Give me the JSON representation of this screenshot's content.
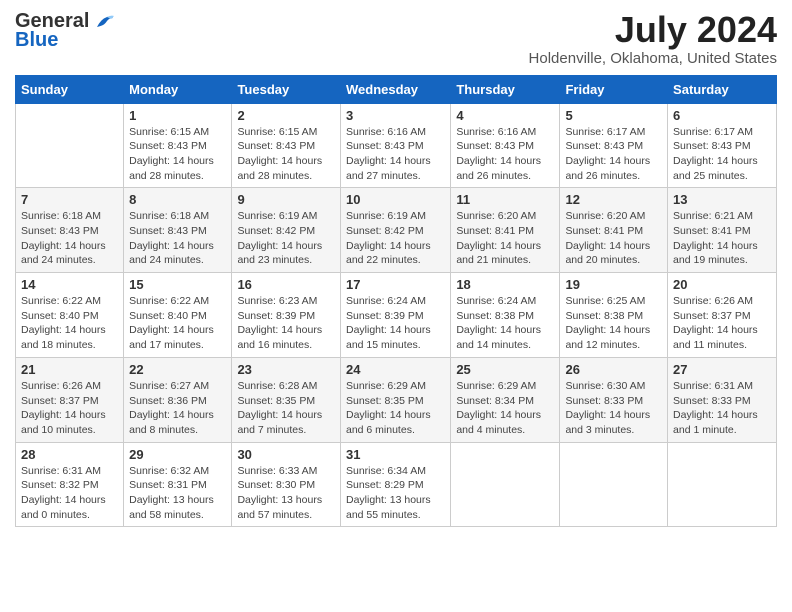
{
  "logo": {
    "general": "General",
    "blue": "Blue"
  },
  "title": {
    "month_year": "July 2024",
    "location": "Holdenville, Oklahoma, United States"
  },
  "calendar": {
    "headers": [
      "Sunday",
      "Monday",
      "Tuesday",
      "Wednesday",
      "Thursday",
      "Friday",
      "Saturday"
    ],
    "weeks": [
      [
        {
          "day": "",
          "info": ""
        },
        {
          "day": "1",
          "info": "Sunrise: 6:15 AM\nSunset: 8:43 PM\nDaylight: 14 hours\nand 28 minutes."
        },
        {
          "day": "2",
          "info": "Sunrise: 6:15 AM\nSunset: 8:43 PM\nDaylight: 14 hours\nand 28 minutes."
        },
        {
          "day": "3",
          "info": "Sunrise: 6:16 AM\nSunset: 8:43 PM\nDaylight: 14 hours\nand 27 minutes."
        },
        {
          "day": "4",
          "info": "Sunrise: 6:16 AM\nSunset: 8:43 PM\nDaylight: 14 hours\nand 26 minutes."
        },
        {
          "day": "5",
          "info": "Sunrise: 6:17 AM\nSunset: 8:43 PM\nDaylight: 14 hours\nand 26 minutes."
        },
        {
          "day": "6",
          "info": "Sunrise: 6:17 AM\nSunset: 8:43 PM\nDaylight: 14 hours\nand 25 minutes."
        }
      ],
      [
        {
          "day": "7",
          "info": "Sunrise: 6:18 AM\nSunset: 8:43 PM\nDaylight: 14 hours\nand 24 minutes."
        },
        {
          "day": "8",
          "info": "Sunrise: 6:18 AM\nSunset: 8:43 PM\nDaylight: 14 hours\nand 24 minutes."
        },
        {
          "day": "9",
          "info": "Sunrise: 6:19 AM\nSunset: 8:42 PM\nDaylight: 14 hours\nand 23 minutes."
        },
        {
          "day": "10",
          "info": "Sunrise: 6:19 AM\nSunset: 8:42 PM\nDaylight: 14 hours\nand 22 minutes."
        },
        {
          "day": "11",
          "info": "Sunrise: 6:20 AM\nSunset: 8:41 PM\nDaylight: 14 hours\nand 21 minutes."
        },
        {
          "day": "12",
          "info": "Sunrise: 6:20 AM\nSunset: 8:41 PM\nDaylight: 14 hours\nand 20 minutes."
        },
        {
          "day": "13",
          "info": "Sunrise: 6:21 AM\nSunset: 8:41 PM\nDaylight: 14 hours\nand 19 minutes."
        }
      ],
      [
        {
          "day": "14",
          "info": "Sunrise: 6:22 AM\nSunset: 8:40 PM\nDaylight: 14 hours\nand 18 minutes."
        },
        {
          "day": "15",
          "info": "Sunrise: 6:22 AM\nSunset: 8:40 PM\nDaylight: 14 hours\nand 17 minutes."
        },
        {
          "day": "16",
          "info": "Sunrise: 6:23 AM\nSunset: 8:39 PM\nDaylight: 14 hours\nand 16 minutes."
        },
        {
          "day": "17",
          "info": "Sunrise: 6:24 AM\nSunset: 8:39 PM\nDaylight: 14 hours\nand 15 minutes."
        },
        {
          "day": "18",
          "info": "Sunrise: 6:24 AM\nSunset: 8:38 PM\nDaylight: 14 hours\nand 14 minutes."
        },
        {
          "day": "19",
          "info": "Sunrise: 6:25 AM\nSunset: 8:38 PM\nDaylight: 14 hours\nand 12 minutes."
        },
        {
          "day": "20",
          "info": "Sunrise: 6:26 AM\nSunset: 8:37 PM\nDaylight: 14 hours\nand 11 minutes."
        }
      ],
      [
        {
          "day": "21",
          "info": "Sunrise: 6:26 AM\nSunset: 8:37 PM\nDaylight: 14 hours\nand 10 minutes."
        },
        {
          "day": "22",
          "info": "Sunrise: 6:27 AM\nSunset: 8:36 PM\nDaylight: 14 hours\nand 8 minutes."
        },
        {
          "day": "23",
          "info": "Sunrise: 6:28 AM\nSunset: 8:35 PM\nDaylight: 14 hours\nand 7 minutes."
        },
        {
          "day": "24",
          "info": "Sunrise: 6:29 AM\nSunset: 8:35 PM\nDaylight: 14 hours\nand 6 minutes."
        },
        {
          "day": "25",
          "info": "Sunrise: 6:29 AM\nSunset: 8:34 PM\nDaylight: 14 hours\nand 4 minutes."
        },
        {
          "day": "26",
          "info": "Sunrise: 6:30 AM\nSunset: 8:33 PM\nDaylight: 14 hours\nand 3 minutes."
        },
        {
          "day": "27",
          "info": "Sunrise: 6:31 AM\nSunset: 8:33 PM\nDaylight: 14 hours\nand 1 minute."
        }
      ],
      [
        {
          "day": "28",
          "info": "Sunrise: 6:31 AM\nSunset: 8:32 PM\nDaylight: 14 hours\nand 0 minutes."
        },
        {
          "day": "29",
          "info": "Sunrise: 6:32 AM\nSunset: 8:31 PM\nDaylight: 13 hours\nand 58 minutes."
        },
        {
          "day": "30",
          "info": "Sunrise: 6:33 AM\nSunset: 8:30 PM\nDaylight: 13 hours\nand 57 minutes."
        },
        {
          "day": "31",
          "info": "Sunrise: 6:34 AM\nSunset: 8:29 PM\nDaylight: 13 hours\nand 55 minutes."
        },
        {
          "day": "",
          "info": ""
        },
        {
          "day": "",
          "info": ""
        },
        {
          "day": "",
          "info": ""
        }
      ]
    ]
  }
}
